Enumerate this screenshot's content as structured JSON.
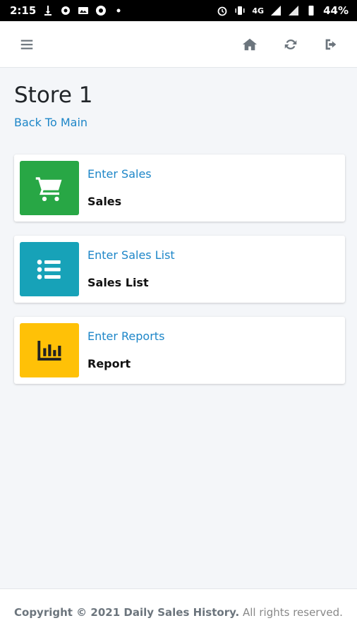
{
  "status_bar": {
    "time": "2:15",
    "network": "4G",
    "battery": "44%"
  },
  "nav": {
    "menu_icon": "menu-icon",
    "home_icon": "home-icon",
    "refresh_icon": "refresh-icon",
    "logout_icon": "logout-icon"
  },
  "page": {
    "title": "Store 1",
    "back_link": "Back To Main"
  },
  "cards": [
    {
      "link": "Enter Sales",
      "label": "Sales",
      "icon": "cart-icon",
      "color": "#28a745"
    },
    {
      "link": "Enter Sales List",
      "label": "Sales List",
      "icon": "list-icon",
      "color": "#17a2b8"
    },
    {
      "link": "Enter Reports",
      "label": "Report",
      "icon": "chart-icon",
      "color": "#ffc107"
    }
  ],
  "footer": {
    "copyright_prefix": "Copyright © 2021 Daily Sales History.",
    "rights": "All rights reserved."
  }
}
